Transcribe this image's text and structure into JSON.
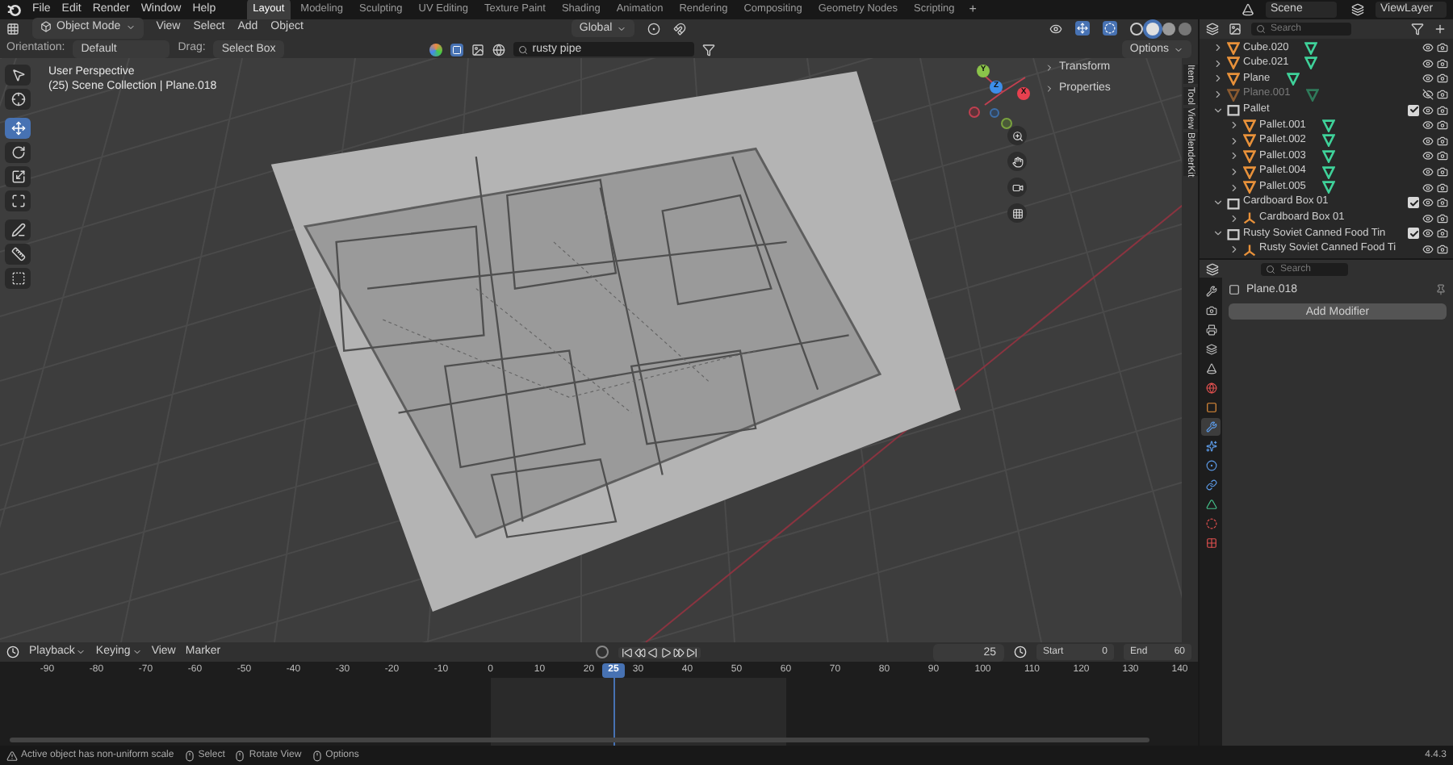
{
  "menu": [
    "File",
    "Edit",
    "Render",
    "Window",
    "Help"
  ],
  "workspaces": [
    {
      "label": "Layout",
      "selected": true
    },
    {
      "label": "Modeling",
      "selected": false
    },
    {
      "label": "Sculpting",
      "selected": false
    },
    {
      "label": "UV Editing",
      "selected": false
    },
    {
      "label": "Texture Paint",
      "selected": false
    },
    {
      "label": "Shading",
      "selected": false
    },
    {
      "label": "Animation",
      "selected": false
    },
    {
      "label": "Rendering",
      "selected": false
    },
    {
      "label": "Compositing",
      "selected": false
    },
    {
      "label": "Geometry Nodes",
      "selected": false
    },
    {
      "label": "Scripting",
      "selected": false
    }
  ],
  "add_workspace": "+",
  "scene": "Scene",
  "view_layer": "ViewLayer",
  "viewport": {
    "mode": "Object Mode",
    "menus": [
      "View",
      "Select",
      "Add",
      "Object"
    ],
    "transform": "Global",
    "orientation_label": "Orientation:",
    "orientation": "Default",
    "drag_label": "Drag:",
    "drag": "Select Box",
    "search": "rusty pipe",
    "options": "Options",
    "overlay_lines": [
      "User Perspective",
      "(25) Scene Collection | Plane.018"
    ],
    "axes": [
      {
        "label": "Y",
        "color": "#8bc34a"
      },
      {
        "label": "Z",
        "color": "#3d8eea"
      },
      {
        "label": "X",
        "color": "#e8404f"
      }
    ],
    "panels": [
      "Transform",
      "Properties"
    ],
    "sidebar_tabs": [
      "Item",
      "Tool",
      "View",
      "BlenderKit"
    ],
    "tools": [
      {
        "kind": "select",
        "selected": false
      },
      {
        "kind": "cursor",
        "selected": false
      },
      {
        "kind": "move",
        "selected": true
      },
      {
        "kind": "rotate",
        "selected": false
      },
      {
        "kind": "scale",
        "selected": false
      },
      {
        "kind": "transform",
        "selected": false
      },
      {
        "kind": "annotate",
        "selected": false
      },
      {
        "kind": "measure",
        "selected": false
      },
      {
        "kind": "add_cube",
        "selected": false
      }
    ]
  },
  "outliner": {
    "placeholder": "Search",
    "items": [
      {
        "kind": "mesh",
        "name": "Cube.020",
        "expanded": false,
        "hidden": false
      },
      {
        "kind": "mesh",
        "name": "Cube.021",
        "expanded": false,
        "hidden": false
      },
      {
        "kind": "mesh",
        "name": "Plane",
        "expanded": false,
        "hidden": false
      },
      {
        "kind": "mesh",
        "name": "Plane.001",
        "expanded": false,
        "hidden": true
      },
      {
        "kind": "collection",
        "name": "Pallet",
        "expanded": true,
        "checked": true,
        "hidden": false,
        "children": [
          {
            "kind": "mesh",
            "name": "Pallet.001",
            "expanded": false,
            "hidden": false
          },
          {
            "kind": "mesh",
            "name": "Pallet.002",
            "expanded": false,
            "hidden": false
          },
          {
            "kind": "mesh",
            "name": "Pallet.003",
            "expanded": false,
            "hidden": false
          },
          {
            "kind": "mesh",
            "name": "Pallet.004",
            "expanded": false,
            "hidden": false
          },
          {
            "kind": "mesh",
            "name": "Pallet.005",
            "expanded": false,
            "hidden": false
          }
        ]
      },
      {
        "kind": "collection",
        "name": "Cardboard Box 01",
        "expanded": true,
        "checked": true,
        "hidden": false,
        "children": [
          {
            "kind": "empty",
            "name": "Cardboard Box 01",
            "expanded": false,
            "hidden": false
          }
        ]
      },
      {
        "kind": "collection",
        "name": "Rusty Soviet Canned Food Tin",
        "expanded": true,
        "checked": true,
        "hidden": false,
        "children": [
          {
            "kind": "empty",
            "name": "Rusty Soviet Canned Food Ti",
            "expanded": false,
            "hidden": false
          }
        ]
      }
    ]
  },
  "properties": {
    "placeholder": "Search",
    "object": "Plane.018",
    "add_modifier": "Add Modifier",
    "tabs": [
      {
        "kind": "tool",
        "selected": false
      },
      {
        "kind": "render",
        "selected": false
      },
      {
        "kind": "output",
        "selected": false
      },
      {
        "kind": "view_layer",
        "selected": false
      },
      {
        "kind": "scene",
        "selected": false
      },
      {
        "kind": "world",
        "selected": false
      },
      {
        "kind": "object",
        "selected": false
      },
      {
        "kind": "modifiers",
        "selected": true
      },
      {
        "kind": "particles",
        "selected": false
      },
      {
        "kind": "physics",
        "selected": false
      },
      {
        "kind": "constraints",
        "selected": false
      },
      {
        "kind": "data",
        "selected": false
      },
      {
        "kind": "material",
        "selected": false
      },
      {
        "kind": "texture",
        "selected": false
      }
    ]
  },
  "timeline": {
    "menus": [
      "Playback",
      "Keying",
      "View",
      "Marker"
    ],
    "frame": "25",
    "start_label": "Start",
    "start": "0",
    "end_label": "End",
    "end": "60",
    "playhead": "25",
    "ticks": [
      "-90",
      "-80",
      "-70",
      "-60",
      "-50",
      "-40",
      "-30",
      "-20",
      "-10",
      "0",
      "10",
      "20",
      "30",
      "40",
      "50",
      "60",
      "70",
      "80",
      "90",
      "100",
      "110",
      "120",
      "130",
      "140"
    ]
  },
  "status_bar": {
    "hints": [
      {
        "kind": "warning",
        "text": "Active object has non-uniform scale"
      },
      {
        "kind": "mouse_left",
        "text": "Select"
      },
      {
        "kind": "mouse_middle",
        "text": "Rotate View"
      },
      {
        "kind": "mouse_right",
        "text": "Options"
      }
    ],
    "version": "4.4.3"
  }
}
